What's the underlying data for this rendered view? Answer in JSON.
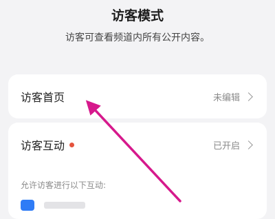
{
  "header": {
    "title": "访客模式",
    "subtitle": "访客可查看频道内所有公开内容。"
  },
  "visitor_home": {
    "label": "访客首页",
    "status": "未编辑"
  },
  "visitor_interaction": {
    "label": "访客互动",
    "status": "已开启",
    "dot_color": "#e5533d",
    "hint": "允许访客进行以下互动:"
  },
  "colors": {
    "background": "#f3f3f5",
    "card": "#ffffff",
    "annotation_arrow": "#d6198c",
    "toggle_icon": "#2f7cf6"
  },
  "icons": {
    "chevron": "chevron-right-icon"
  }
}
